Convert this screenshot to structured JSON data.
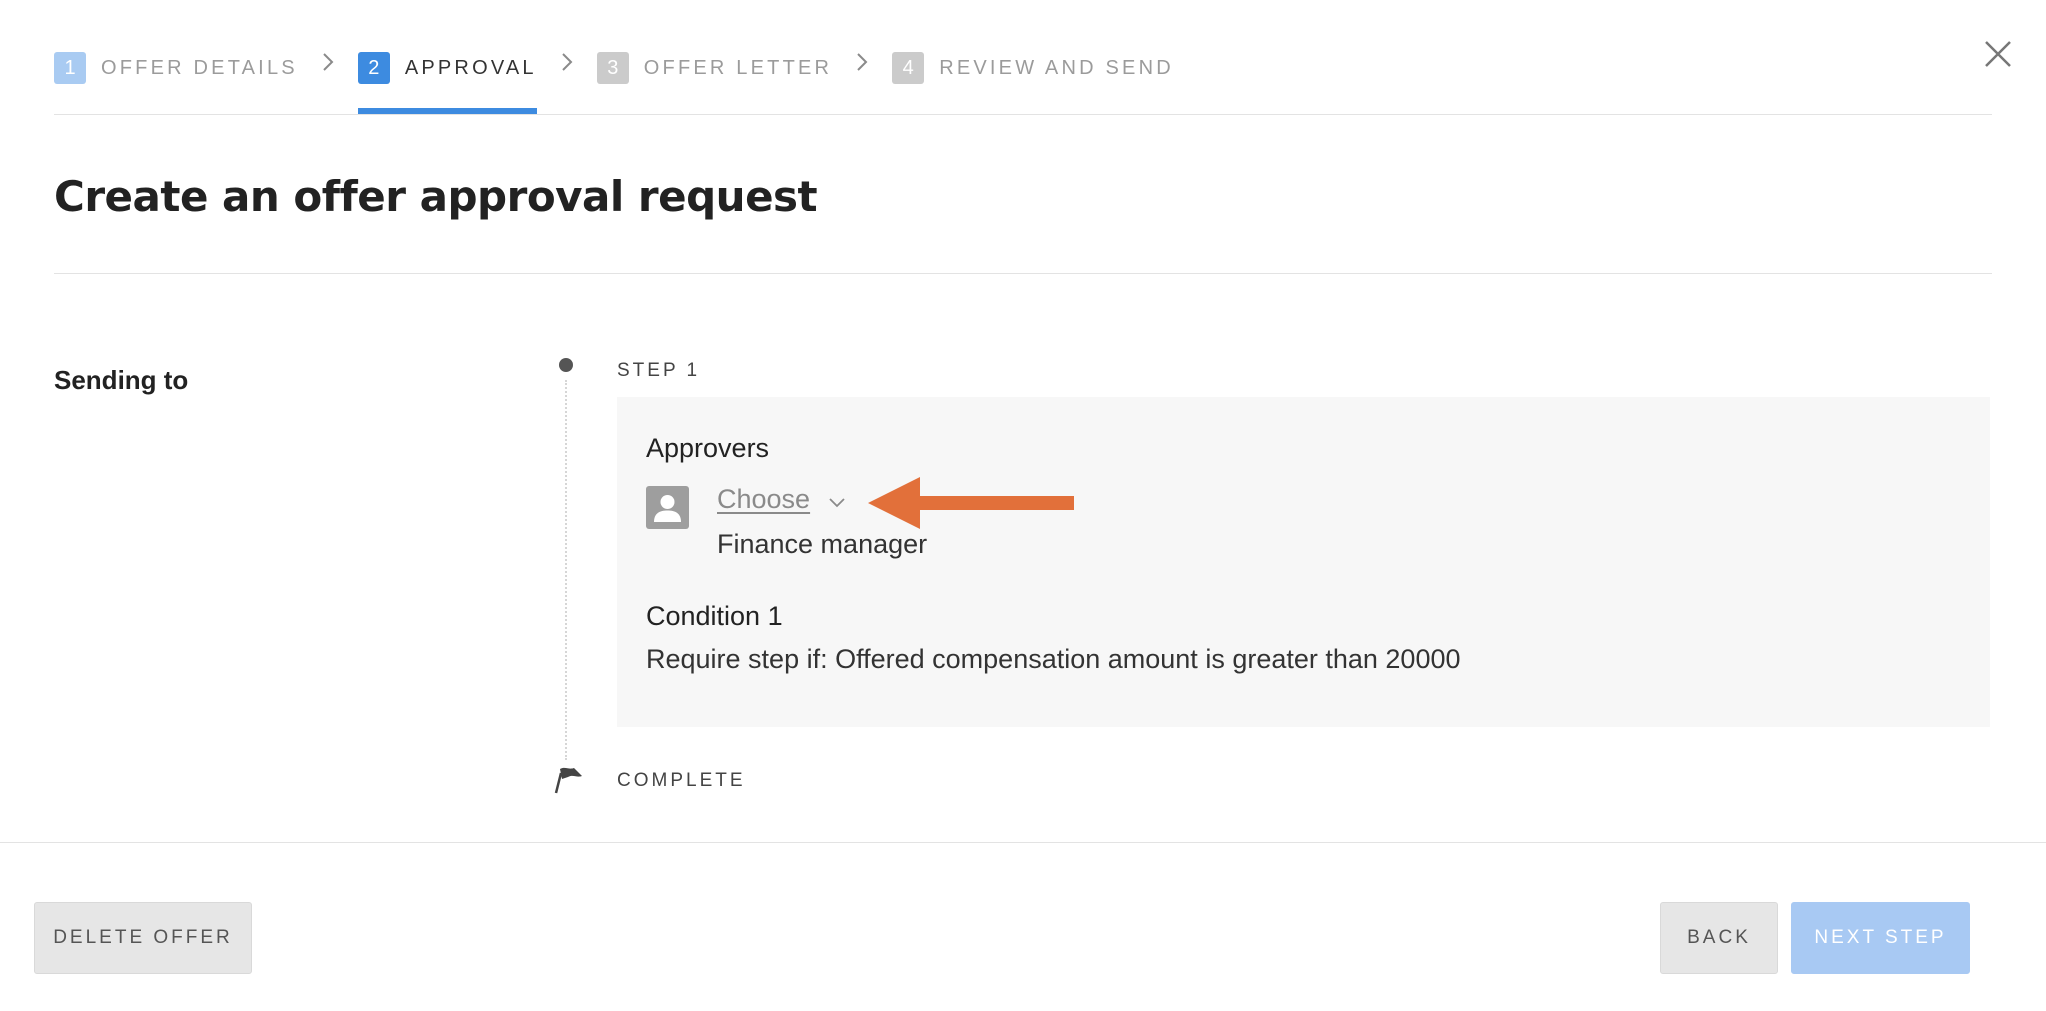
{
  "stepper": {
    "steps": [
      {
        "number": "1",
        "label": "OFFER DETAILS",
        "state": "done"
      },
      {
        "number": "2",
        "label": "APPROVAL",
        "state": "active"
      },
      {
        "number": "3",
        "label": "OFFER LETTER",
        "state": "todo"
      },
      {
        "number": "4",
        "label": "REVIEW AND SEND",
        "state": "todo"
      }
    ]
  },
  "page": {
    "title": "Create an offer approval request"
  },
  "sending": {
    "label": "Sending to",
    "step_label": "STEP 1",
    "complete_label": "COMPLETE"
  },
  "approval_card": {
    "approvers_heading": "Approvers",
    "choose_link": "Choose",
    "role": "Finance manager",
    "condition_heading": "Condition 1",
    "condition_text": "Require step if: Offered compensation amount is greater than 20000"
  },
  "footer": {
    "delete_label": "DELETE OFFER",
    "back_label": "BACK",
    "next_label": "NEXT STEP"
  },
  "colors": {
    "accent": "#3d8be0",
    "accent_light": "#a8c9f3",
    "annotation_arrow": "#e2703a"
  },
  "icons": [
    "chevron-right-icon",
    "close-icon",
    "user-avatar-icon",
    "chevron-down-icon",
    "flag-icon",
    "arrow-annotation"
  ]
}
